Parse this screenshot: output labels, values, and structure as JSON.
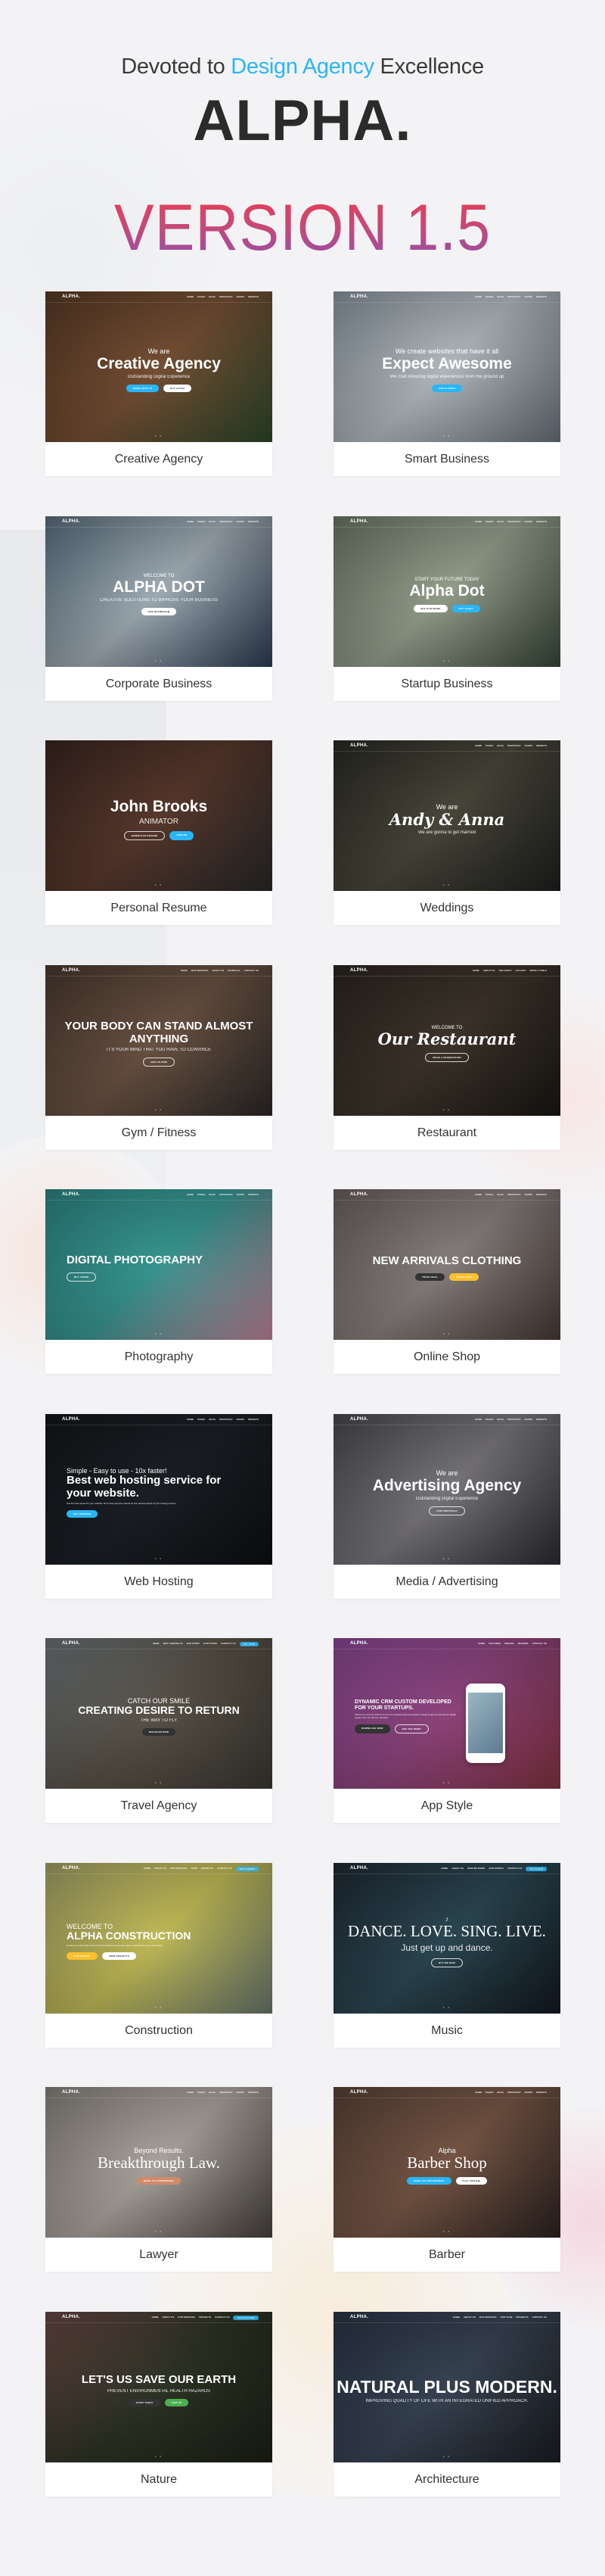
{
  "header": {
    "tagline_prefix": "Devoted to ",
    "tagline_accent": "Design Agency",
    "tagline_suffix": " Excellence",
    "brand": "ALPHA.",
    "version": "VERSION 1.5",
    "colors": {
      "accent": "#29b6f6",
      "brand": "#2b2b2b",
      "version_gradient_top": "#ee3b4f",
      "version_gradient_bottom": "#8e4fb0"
    }
  },
  "default_nav": [
    "HOME",
    "PAGES",
    "BLOG",
    "PORTFOLIO",
    "SHOPS",
    "WIDGETS"
  ],
  "demos": [
    {
      "label": "Creative Agency",
      "logo": "ALPHA.",
      "nav": [
        "HOME",
        "PAGES",
        "BLOG",
        "PORTFOLIO",
        "SHOPS",
        "WIDGETS"
      ],
      "kicker": "We are",
      "title": "Creative Agency",
      "sub": "Outstanding Digital Experience",
      "buttons": [
        {
          "label": "WORK WITH US",
          "color": "#29b6f6"
        },
        {
          "label": "BUY ALPHA",
          "color": "#ffffff"
        }
      ],
      "bg": [
        "#5a3b25",
        "#7a5236",
        "#2f4a2b"
      ]
    },
    {
      "label": "Smart Business",
      "logo": "ALPHA.",
      "nav": [
        "HOME",
        "PAGES",
        "BLOG",
        "PORTFOLIO",
        "SHOPS",
        "WIDGETS"
      ],
      "kicker": "We create websites that have it all",
      "title": "Expect Awesome",
      "sub": "We craft Amazing digital experiences from the ground up",
      "buttons": [
        {
          "label": "OUR CLIENTS",
          "color": "#29b6f6"
        }
      ],
      "bg": [
        "#8e9aa3",
        "#b9c1c6",
        "#6d7780"
      ]
    },
    {
      "label": "Corporate Business",
      "logo": "ALPHA.",
      "nav": [
        "HOME",
        "PAGES",
        "BLOG",
        "PORTFOLIO",
        "SHOPS",
        "WIDGETS"
      ],
      "kicker": "WELCOME TO",
      "title": "ALPHA DOT",
      "sub": "CREATIVE SOLUTIONS TO IMPROVE YOUR BUSINESS",
      "buttons": [
        {
          "label": "OUR BUSINESS ▶",
          "color": "#ffffff"
        }
      ],
      "bg": [
        "#5d7282",
        "#a7b4bd",
        "#2f3f55"
      ]
    },
    {
      "label": "Startup Business",
      "logo": "ALPHA.",
      "nav": [
        "HOME",
        "PAGES",
        "BLOG",
        "PORTFOLIO",
        "SHOPS",
        "WIDGETS"
      ],
      "kicker": "START YOUR FUTURE TODAY",
      "title": "Alpha Dot",
      "sub": "",
      "buttons": [
        {
          "label": "SEE OUR WORK",
          "color": "#ffffff"
        },
        {
          "label": "BUY ALPHA",
          "color": "#29b6f6"
        }
      ],
      "bg": [
        "#6f7a68",
        "#9ba592",
        "#3a4a3a"
      ]
    },
    {
      "label": "Personal Resume",
      "logo": "",
      "nav": [],
      "kicker": "",
      "title": "John Brooks",
      "sub": "ANIMATOR",
      "buttons": [
        {
          "label": "DOWNLOAD RESUME",
          "color": "transparent"
        },
        {
          "label": "HIRE ME",
          "color": "#29b6f6"
        }
      ],
      "bg": [
        "#3a2620",
        "#5b3a2e",
        "#2a2a2a"
      ]
    },
    {
      "label": "Weddings",
      "logo": "ALPHA.",
      "nav": [
        "HOME",
        "PAGES",
        "BLOG",
        "PORTFOLIO",
        "SHOPS",
        "WIDGETS"
      ],
      "kicker": "We are",
      "title": "Andy & Anna",
      "sub": "We are gonna to get married",
      "buttons": [],
      "bg": [
        "#2a2a24",
        "#4b4a3c",
        "#1f1f1f"
      ]
    },
    {
      "label": "Gym / Fitness",
      "logo": "ALPHA.",
      "nav": [
        "HOME",
        "OUR SERVICES",
        "ABOUT US",
        "SCHEDULE",
        "CONTACT US"
      ],
      "kicker": "",
      "title": "YOUR BODY CAN STAND ALMOST ANYTHING",
      "sub": "IT'S YOUR MIND THAT YOU HAVE TO CONVINCE",
      "buttons": [
        {
          "label": "JOIN US NOW",
          "color": "transparent"
        }
      ],
      "bg": [
        "#4a3a30",
        "#6d5545",
        "#2e2a28"
      ]
    },
    {
      "label": "Restaurant",
      "logo": "ALPHA.",
      "nav": [
        "HOME",
        "ABOUT US",
        "THE CHEFS",
        "GALLERY",
        "BOOK A TABLE"
      ],
      "kicker": "WELCOME TO",
      "title": "Our Restaurant",
      "sub": "",
      "buttons": [
        {
          "label": "MAKE A RESERVATION",
          "color": "transparent"
        }
      ],
      "bg": [
        "#2c2620",
        "#3f362c",
        "#1a1714"
      ]
    },
    {
      "label": "Photography",
      "logo": "ALPHA.",
      "nav": [
        "HOME",
        "PAGES",
        "BLOG",
        "PORTFOLIO",
        "SHOPS",
        "WIDGETS"
      ],
      "kicker": "",
      "title": "DIGITAL PHOTOGRAPHY",
      "sub": "",
      "buttons": [
        {
          "label": "BUY THEME",
          "color": "transparent"
        }
      ],
      "bg": [
        "#2e8a88",
        "#3a9c97",
        "#c98aa0"
      ]
    },
    {
      "label": "Online Shop",
      "logo": "ALPHA.",
      "nav": [
        "HOME",
        "PAGES",
        "BLOG",
        "PORTFOLIO",
        "SHOPS",
        "WIDGETS"
      ],
      "kicker": "",
      "title": "NEW ARRIVALS CLOTHING",
      "sub": "",
      "buttons": [
        {
          "label": "TODAY DEAL",
          "color": "#333333"
        },
        {
          "label": "GO TO SHOP",
          "color": "#fbc02d"
        }
      ],
      "bg": [
        "#6b6361",
        "#8c8482",
        "#4b3c37"
      ]
    },
    {
      "label": "Web Hosting",
      "logo": "ALPHA.",
      "nav": [
        "HOME",
        "PAGES",
        "BLOG",
        "PORTFOLIO",
        "SHOPS",
        "WIDGETS"
      ],
      "kicker": "Simple - Easy to use - 10x faster!",
      "title": "Best web hosting service for your website.",
      "sub": "Get the best speed for your website. Don't lose anymore clients for the slowest speed of your hosting service.",
      "buttons": [
        {
          "label": "GET STARTED",
          "color": "#29b6f6"
        }
      ],
      "bg": [
        "#14161a",
        "#1c2026",
        "#0e0f12"
      ]
    },
    {
      "label": "Media / Advertising",
      "logo": "ALPHA.",
      "nav": [
        "HOME",
        "PAGES",
        "BLOG",
        "PORTFOLIO",
        "SHOPS",
        "WIDGETS"
      ],
      "kicker": "We are",
      "title": "Advertising Agency",
      "sub": "Outstanding Digital Experience",
      "buttons": [
        {
          "label": "OUR PORTFOLIO",
          "color": "transparent"
        }
      ],
      "bg": [
        "#4a4a4f",
        "#7d7b80",
        "#2d2d33"
      ]
    },
    {
      "label": "Travel Agency",
      "logo": "ALPHA.",
      "nav": [
        "HOME",
        "WHY CHOOSE US",
        "OUR STORY",
        "OUR TOURS",
        "CONTACT US"
      ],
      "nav_cta": "GET TOUR",
      "kicker": "CATCH OUR SMILE",
      "title": "CREATING DESIRE TO RETURN",
      "sub": "THE WAY TO FLY",
      "buttons": [
        {
          "label": "DISCOVER NOW",
          "color": "#333333"
        }
      ],
      "bg": [
        "#6f767a",
        "#5b554a",
        "#3d3a33"
      ]
    },
    {
      "label": "App Style",
      "logo": "ALPHA.",
      "nav": [
        "HOME",
        "FEATURES",
        "PRICING",
        "REVIEWS",
        "CONTACT US"
      ],
      "kicker": "",
      "title": "DYNAMIC CRM CUSTOM DEVELOPED FOR YOUR STARTUPS.",
      "sub": "Started as early as internet we are the leading business analytics solutions agency serving the digital empire from the last two decades.",
      "buttons": [
        {
          "label": "DOWNLOAD NOW",
          "color": "#333333"
        },
        {
          "label": "SEE THE DEMO",
          "color": "transparent"
        }
      ],
      "bg": [
        "#8e4a9a",
        "#934781",
        "#8a3545"
      ]
    },
    {
      "label": "Construction",
      "logo": "ALPHA.",
      "nav": [
        "HOME",
        "ABOUT US",
        "OUR SERVICES",
        "TEAM",
        "PROJECTS",
        "CONTACT US"
      ],
      "nav_cta": "GET A QUOTE",
      "kicker": "WELCOME TO",
      "title": "ALPHA CONSTRUCTION",
      "sub": "Creating a sustainable future through building preservation green architecture and smart design.",
      "buttons": [
        {
          "label": "OUR HISTORY",
          "color": "#fbc02d"
        },
        {
          "label": "VIEW PROJECTS",
          "color": "#ffffff"
        }
      ],
      "bg": [
        "#a9a66a",
        "#c9c35a",
        "#6f7d73"
      ]
    },
    {
      "label": "Music",
      "logo": "ALPHA.",
      "nav": [
        "HOME",
        "ABOUT US",
        "HOW WE WORK",
        "OUR EVENTS",
        "CONTACT US"
      ],
      "nav_cta": "GET ALBUM",
      "kicker": "♪",
      "title": "DANCE. LOVE. SING. LIVE.",
      "sub": "Just get up and dance.",
      "buttons": [
        {
          "label": "BUY ME NOW",
          "color": "transparent"
        }
      ],
      "bg": [
        "#1f2a36",
        "#2d4a55",
        "#141a22"
      ]
    },
    {
      "label": "Lawyer",
      "logo": "ALPHA.",
      "nav": [
        "HOME",
        "PAGES",
        "BLOG",
        "PORTFOLIO",
        "SHOPS",
        "WIDGETS"
      ],
      "kicker": "Beyond Results.",
      "title": "Breakthrough Law.",
      "sub": "",
      "buttons": [
        {
          "label": "BOOK AN APPOINTMENT",
          "color": "#d08a6a"
        }
      ],
      "bg": [
        "#8a8580",
        "#b2aba4",
        "#4a4440"
      ]
    },
    {
      "label": "Barber",
      "logo": "ALPHA.",
      "nav": [
        "HOME",
        "PAGES",
        "BLOG",
        "PORTFOLIO",
        "SHOPS",
        "WIDGETS"
      ],
      "kicker": "Alpha",
      "title": "Barber Shop",
      "sub": "",
      "buttons": [
        {
          "label": "BOOK AN APPOINTMENT",
          "color": "#29b6f6"
        },
        {
          "label": "PLAY VIDEO ▶",
          "color": "#ffffff"
        }
      ],
      "bg": [
        "#5a4338",
        "#7b5a48",
        "#2e2422"
      ]
    },
    {
      "label": "Nature",
      "logo": "ALPHA.",
      "nav": [
        "HOME",
        "ABOUT US",
        "OUR SERVICES",
        "PROJECTS",
        "CONTACT US"
      ],
      "nav_cta": "REGISTER NOW",
      "kicker": "",
      "title": "LET'S US SAVE OUR EARTH",
      "sub": "PREVENT ENVIRONMENTAL HEALTH HAZARDS",
      "buttons": [
        {
          "label": "START TODAY",
          "color": "#333333"
        },
        {
          "label": "SIGN UP",
          "color": "#4caf50"
        }
      ],
      "bg": [
        "#6a4a44",
        "#2f3526",
        "#1c2116"
      ]
    },
    {
      "label": "Architecture",
      "logo": "ALPHA.",
      "nav": [
        "HOME",
        "ABOUT US",
        "OUR SERVICES",
        "OUR TEAM",
        "PROJECTS",
        "CONTACT US"
      ],
      "kicker": "",
      "title": "NATURAL PLUS MODERN.",
      "sub": "IMPROVING QUALITY OF LIFE WITH AN INTEGRATED UNIFIED APPROACH.",
      "buttons": [],
      "bg": [
        "#2a3646",
        "#3a4656",
        "#1b1f24"
      ]
    }
  ]
}
